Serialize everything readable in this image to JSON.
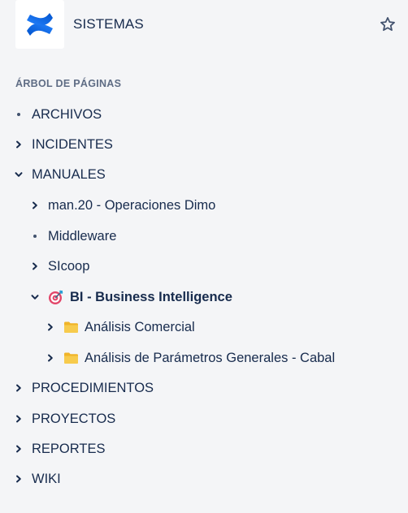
{
  "header": {
    "space_name": "SISTEMAS",
    "logo_icon": "confluence-logo",
    "star_icon": "star-outline-icon"
  },
  "page_tree": {
    "title": "ÁRBOL DE PÁGINAS",
    "items": [
      {
        "label": "ARCHIVOS",
        "toggle": "bullet",
        "level": 0
      },
      {
        "label": "INCIDENTES",
        "toggle": "collapsed",
        "level": 0
      },
      {
        "label": "MANUALES",
        "toggle": "expanded",
        "level": 0
      },
      {
        "label": "man.20 - Operaciones Dimo",
        "toggle": "collapsed",
        "level": 1
      },
      {
        "label": "Middleware",
        "toggle": "bullet",
        "level": 1
      },
      {
        "label": "SIcoop",
        "toggle": "collapsed",
        "level": 1
      },
      {
        "label": "BI - Business Intelligence",
        "toggle": "expanded",
        "level": 1,
        "icon": "dart-target-emoji",
        "current": true
      },
      {
        "label": "Análisis Comercial",
        "toggle": "collapsed",
        "level": 2,
        "icon": "folder-icon"
      },
      {
        "label": "Análisis de Parámetros Generales - Cabal",
        "toggle": "collapsed",
        "level": 2,
        "icon": "folder-icon"
      },
      {
        "label": "PROCEDIMIENTOS",
        "toggle": "collapsed",
        "level": 0
      },
      {
        "label": "PROYECTOS",
        "toggle": "collapsed",
        "level": 0
      },
      {
        "label": "REPORTES",
        "toggle": "collapsed",
        "level": 0
      },
      {
        "label": "WIKI",
        "toggle": "collapsed",
        "level": 0
      }
    ]
  },
  "colors": {
    "background": "#f4f5f7",
    "text": "#172b4d",
    "muted": "#5e6c84",
    "logo_blue_dark": "#0052cc",
    "logo_blue_light": "#2684ff",
    "folder_yellow": "#f5c518"
  }
}
